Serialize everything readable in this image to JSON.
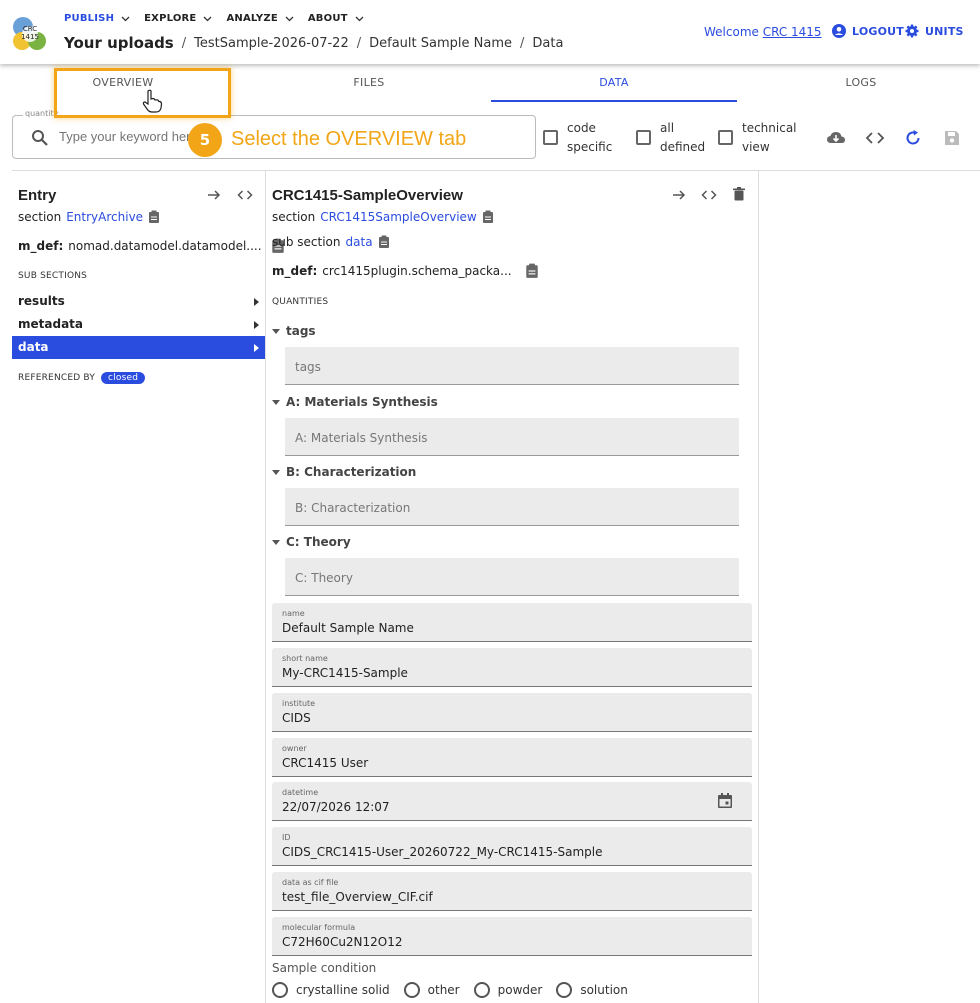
{
  "header": {
    "logo_text": [
      "CRC",
      "1415"
    ],
    "nav": [
      {
        "label": "PUBLISH",
        "active": true
      },
      {
        "label": "EXPLORE",
        "active": false
      },
      {
        "label": "ANALYZE",
        "active": false
      },
      {
        "label": "ABOUT",
        "active": false
      }
    ],
    "breadcrumb": {
      "root": "Your uploads",
      "items": [
        "TestSample-2026-07-22",
        "Default Sample Name",
        "Data"
      ]
    },
    "welcome_prefix": "Welcome",
    "welcome_user": "CRC 1415",
    "logout_label": "LOGOUT",
    "units_label": "UNITS"
  },
  "tabs": [
    {
      "label": "OVERVIEW",
      "active": false
    },
    {
      "label": "FILES",
      "active": false
    },
    {
      "label": "DATA",
      "active": true
    },
    {
      "label": "LOGS",
      "active": false
    }
  ],
  "tutorial": {
    "step": "5",
    "text": "Select the OVERVIEW tab"
  },
  "search": {
    "label": "quantity",
    "placeholder": "Type your keyword here"
  },
  "filters": [
    {
      "label1": "code",
      "label2": "specific"
    },
    {
      "label1": "all",
      "label2": "defined"
    },
    {
      "label1": "technical",
      "label2": "view"
    }
  ],
  "entry": {
    "title": "Entry",
    "section_label": "section",
    "section_value": "EntryArchive",
    "mdef_label": "m_def:",
    "mdef_value": "nomad.datamodel.datamodel....",
    "subsections_label": "SUB SECTIONS",
    "subsections": [
      {
        "label": "results",
        "selected": false
      },
      {
        "label": "metadata",
        "selected": false
      },
      {
        "label": "data",
        "selected": true
      }
    ],
    "referenced_by_label": "REFERENCED BY",
    "referenced_by_chip": "closed"
  },
  "overview": {
    "title": "CRC1415-SampleOverview",
    "section_label": "section",
    "section_value": "CRC1415SampleOverview",
    "subsection_label": "sub section",
    "subsection_value": "data",
    "mdef_label": "m_def:",
    "mdef_value": "crc1415plugin.schema_packa...",
    "quantities_label": "QUANTITIES",
    "groups": [
      {
        "label": "tags",
        "placeholder": "tags"
      },
      {
        "label": "A: Materials Synthesis",
        "placeholder": "A: Materials Synthesis"
      },
      {
        "label": "B: Characterization",
        "placeholder": "B: Characterization"
      },
      {
        "label": "C: Theory",
        "placeholder": "C: Theory"
      }
    ],
    "fields": [
      {
        "label": "name",
        "value": "Default Sample Name"
      },
      {
        "label": "short name",
        "value": "My-CRC1415-Sample"
      },
      {
        "label": "institute",
        "value": "CIDS"
      },
      {
        "label": "owner",
        "value": "CRC1415 User"
      },
      {
        "label": "datetime",
        "value": "22/07/2026 12:07"
      },
      {
        "label": "ID",
        "value": "CIDS_CRC1415-User_20260722_My-CRC1415-Sample"
      },
      {
        "label": "data as cif file",
        "value": "test_file_Overview_CIF.cif"
      },
      {
        "label": "molecular formula",
        "value": "C72H60Cu2N12O12"
      }
    ],
    "sample_condition_label": "Sample condition",
    "sample_conditions": [
      "crystalline solid",
      "other",
      "powder",
      "solution"
    ]
  }
}
